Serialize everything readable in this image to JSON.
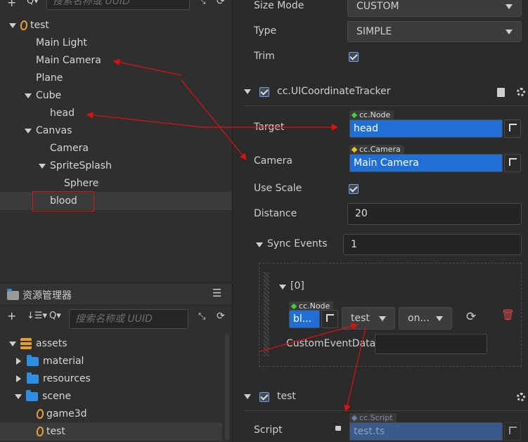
{
  "hierarchy": {
    "search_placeholder": "搜索名称或 UUID",
    "nodes": [
      {
        "label": "test"
      },
      {
        "label": "Main Light"
      },
      {
        "label": "Main Camera"
      },
      {
        "label": "Plane"
      },
      {
        "label": "Cube"
      },
      {
        "label": "head"
      },
      {
        "label": "Canvas"
      },
      {
        "label": "Camera"
      },
      {
        "label": "SpriteSplash"
      },
      {
        "label": "Sphere"
      },
      {
        "label": "blood"
      }
    ]
  },
  "assets": {
    "title": "资源管理器",
    "search_placeholder": "搜索名称或 UUID",
    "items": [
      {
        "label": "assets"
      },
      {
        "label": "material"
      },
      {
        "label": "resources"
      },
      {
        "label": "scene"
      },
      {
        "label": "game3d"
      },
      {
        "label": "test"
      }
    ]
  },
  "inspector": {
    "size_mode_label": "Size Mode",
    "size_mode_value": "CUSTOM",
    "type_label": "Type",
    "type_value": "SIMPLE",
    "trim_label": "Trim",
    "tracker": {
      "title": "cc.UICoordinateTracker",
      "target_label": "Target",
      "target_tag": "cc.Node",
      "target_value": "head",
      "camera_label": "Camera",
      "camera_tag": "cc.Camera",
      "camera_value": "Main Camera",
      "use_scale_label": "Use Scale",
      "distance_label": "Distance",
      "distance_value": "20",
      "sync_events_label": "Sync Events",
      "sync_events_value": "1",
      "event": {
        "index_label": "[0]",
        "node_tag": "cc.Node",
        "node_value": "bl...",
        "component_value": "test",
        "handler_value": "on...",
        "custom_data_label": "CustomEventData"
      }
    },
    "script_component": {
      "title": "test",
      "script_label": "Script",
      "script_tag": "cc.Script",
      "script_value": "test.ts"
    }
  },
  "colors": {
    "accent": "#1f6fd6",
    "annotation": "#e01010"
  }
}
